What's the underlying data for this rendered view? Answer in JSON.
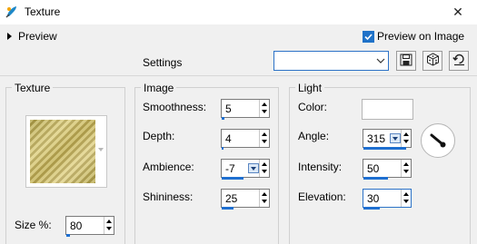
{
  "window": {
    "title": "Texture",
    "close_glyph": "✕"
  },
  "preview": {
    "label": "Preview",
    "preview_on_image_label": "Preview on Image",
    "preview_on_image_checked": true
  },
  "settings": {
    "label": "Settings",
    "value": ""
  },
  "groups": {
    "texture": {
      "title": "Texture",
      "size": {
        "label": "Size %:",
        "value": "80",
        "level": 0.08
      }
    },
    "image": {
      "title": "Image",
      "smoothness": {
        "label": "Smoothness:",
        "value": "5",
        "level": 0.05
      },
      "depth": {
        "label": "Depth:",
        "value": "4",
        "level": 0.04
      },
      "ambience": {
        "label": "Ambience:",
        "value": "-7",
        "level": 0.45
      },
      "shininess": {
        "label": "Shininess:",
        "value": "25",
        "level": 0.25
      }
    },
    "light": {
      "title": "Light",
      "color": {
        "label": "Color:",
        "value": "#ffffff"
      },
      "angle": {
        "label": "Angle:",
        "value": "315",
        "level": 0.87
      },
      "intensity": {
        "label": "Intensity:",
        "value": "50",
        "level": 0.5
      },
      "elevation": {
        "label": "Elevation:",
        "value": "30",
        "level": 0.33
      }
    }
  },
  "colors": {
    "accent": "#1f72c8"
  },
  "icons": {
    "app": "paint-brush-icon",
    "save": "save-preset-icon",
    "randomize": "dice-icon",
    "reset": "reset-icon",
    "checkmark": "checkmark-icon"
  }
}
